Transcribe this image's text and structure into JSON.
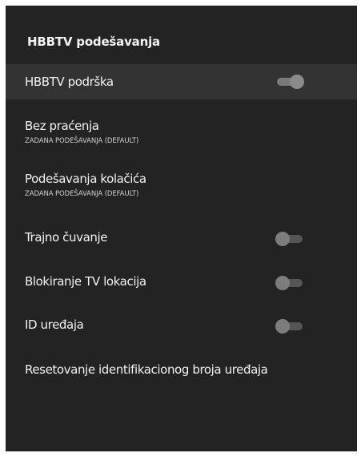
{
  "panel": {
    "title": "HBBTV podešavanja"
  },
  "items": [
    {
      "label": "HBBTV podrška",
      "toggle": "on"
    },
    {
      "label": "Bez praćenja",
      "subtitle": "ZADANA PODEŠAVANJA (DEFAULT)"
    },
    {
      "label": "Podešavanja kolačića",
      "subtitle": "ZADANA PODEŠAVANJA (DEFAULT)"
    },
    {
      "label": "Trajno čuvanje",
      "toggle": "off"
    },
    {
      "label": "Blokiranje TV lokacija",
      "toggle": "off"
    },
    {
      "label": "ID uređaja",
      "toggle": "off"
    },
    {
      "label": "Resetovanje identifikacionog broja uređaja"
    }
  ],
  "colors": {
    "panel_bg": "#232323",
    "focused_row_bg": "#333333",
    "text": "#f2f2f2"
  }
}
